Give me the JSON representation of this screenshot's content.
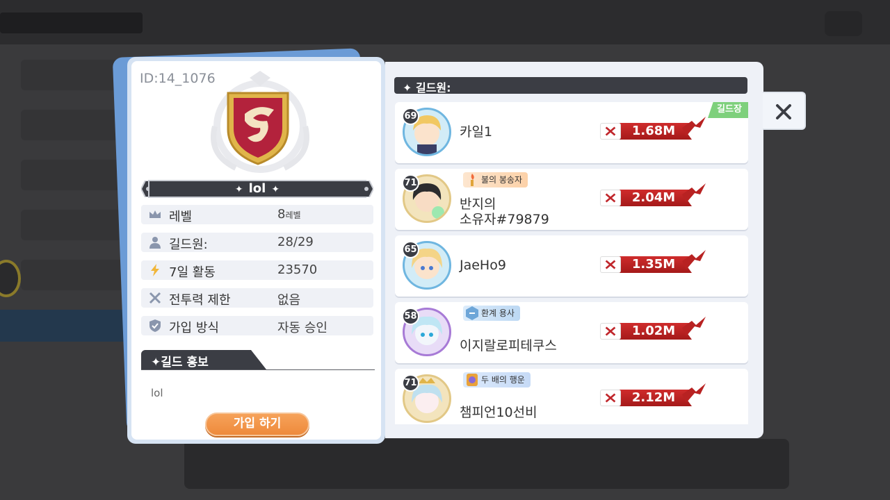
{
  "guild": {
    "id": "ID:14_1076",
    "name": "lol",
    "stats": [
      {
        "icon": "crown-icon",
        "label": "레벨",
        "value": "8",
        "unit": "레벨"
      },
      {
        "icon": "person-icon",
        "label": "길드원:",
        "value": "28/29",
        "unit": ""
      },
      {
        "icon": "lightning-icon",
        "label": "7일 활동",
        "value": "23570",
        "unit": ""
      },
      {
        "icon": "crossed-swords-icon",
        "label": "전투력 제한",
        "value": "없음",
        "unit": ""
      },
      {
        "icon": "shield-check-icon",
        "label": "가입 방식",
        "value": "자동 승인",
        "unit": ""
      }
    ],
    "promo_title": "길드 홍보",
    "promo_text": "lol",
    "join_label": "가입 하기"
  },
  "members_header": "길드원:",
  "members": [
    {
      "level": "71",
      "name": "",
      "title": "",
      "power": ""
    },
    {
      "level": "69",
      "name": "카일1",
      "title": "",
      "power": "1.68M",
      "leader": "길드장"
    },
    {
      "level": "71",
      "name_line1": "반지의",
      "name_line2": "소유자#79879",
      "title": "불의 봉송자",
      "power": "2.04M"
    },
    {
      "level": "65",
      "name": "JaeHo9",
      "title": "",
      "power": "1.35M"
    },
    {
      "level": "58",
      "name": "이지랄로피테쿠스",
      "title": "환계 용사",
      "power": "1.02M"
    },
    {
      "level": "71",
      "name": "챔피언10선비",
      "title": "두 배의 행운",
      "power": "2.12M"
    }
  ],
  "colors": {
    "power_ribbon": "#b82222",
    "join_button": "#ee8a3c",
    "leader_tag": "#7ed07c",
    "panel_header": "#3b3d44"
  }
}
